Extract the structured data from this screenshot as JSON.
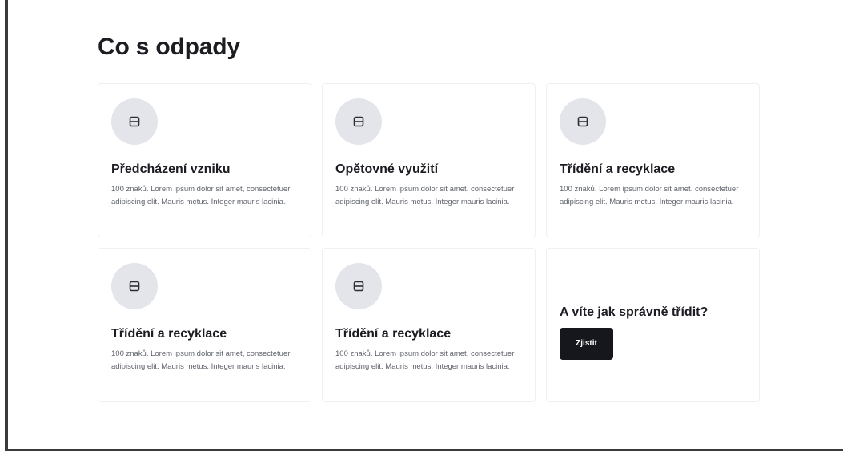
{
  "page": {
    "title": "Co s odpady"
  },
  "cards": [
    {
      "title": "Předcházení vzniku",
      "text": "100 znaků. Lorem ipsum dolor sit amet, consectetuer adipiscing elit. Mauris metus. Integer mauris lacinia.",
      "icon": "image-icon"
    },
    {
      "title": "Opětovné využití",
      "text": "100 znaků. Lorem ipsum dolor sit amet, consectetuer adipiscing elit. Mauris metus. Integer mauris lacinia.",
      "icon": "image-icon"
    },
    {
      "title": "Třídění a recyklace",
      "text": "100 znaků. Lorem ipsum dolor sit amet, consectetuer adipiscing elit. Mauris metus. Integer mauris lacinia.",
      "icon": "image-icon"
    },
    {
      "title": "Třídění a recyklace",
      "text": "100 znaků. Lorem ipsum dolor sit amet, consectetuer adipiscing elit. Mauris metus. Integer mauris lacinia.",
      "icon": "image-icon"
    },
    {
      "title": "Třídění a recyklace",
      "text": "100 znaků. Lorem ipsum dolor sit amet, consectetuer adipiscing elit. Mauris metus. Integer mauris lacinia.",
      "icon": "image-icon"
    }
  ],
  "cta": {
    "title": "A víte jak správně třídit?",
    "button_label": "Zjistit"
  },
  "colors": {
    "text_primary": "#1b1d22",
    "text_secondary": "#5f636b",
    "icon_bg": "#e3e5ea",
    "button_bg": "#15171c",
    "button_text": "#ffffff"
  }
}
